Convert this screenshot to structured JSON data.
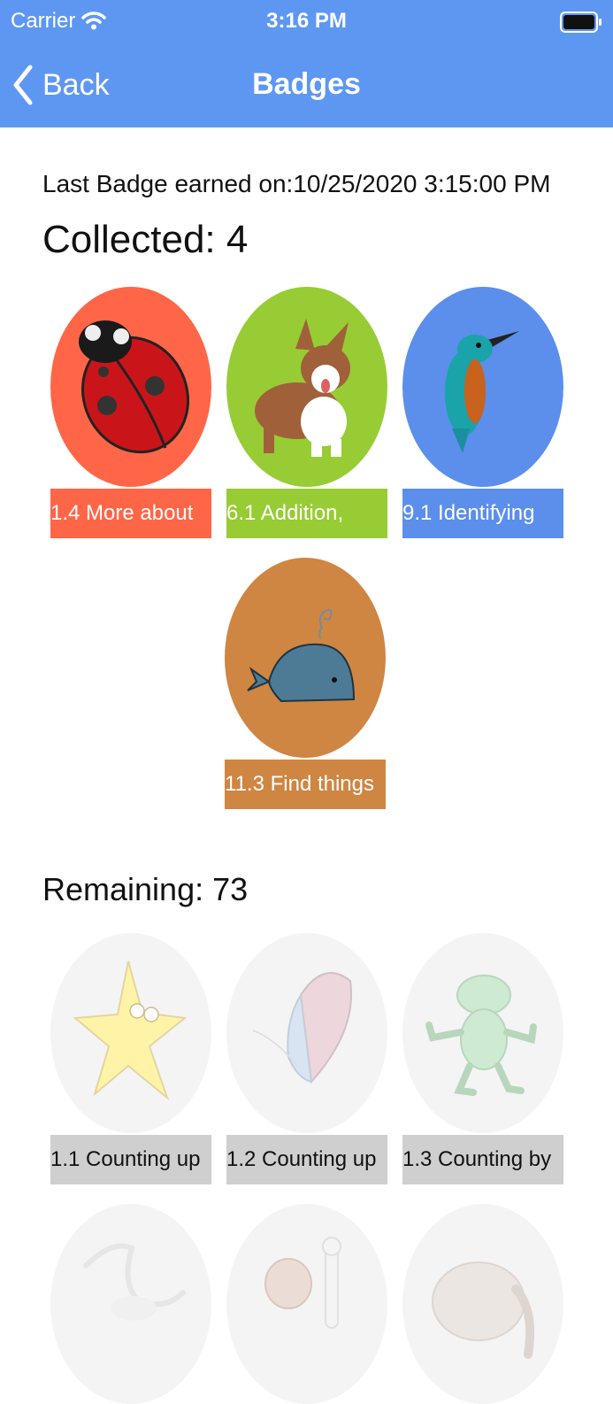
{
  "status_bar": {
    "carrier": "Carrier",
    "time": "3:16 PM"
  },
  "nav": {
    "back_label": "Back",
    "title": "Badges",
    "color": "#5e97f2"
  },
  "last_badge": "Last Badge earned on:10/25/2020 3:15:00 PM",
  "collected": {
    "title": "Collected: 4",
    "items": [
      {
        "caption": "1.4 More about",
        "color": "#ff6647",
        "icon": "ladybug-icon"
      },
      {
        "caption": "6.1 Addition,",
        "color": "#97cc34",
        "icon": "corgi-icon"
      },
      {
        "caption": "9.1 Identifying",
        "color": "#5b8feb",
        "icon": "kingfisher-icon"
      },
      {
        "caption": "11.3 Find things",
        "color": "#cf8642",
        "icon": "whale-icon"
      }
    ]
  },
  "remaining": {
    "title": "Remaining: 73",
    "items": [
      {
        "caption": "1.1 Counting up",
        "icon": "starfish-icon"
      },
      {
        "caption": "1.2 Counting up",
        "icon": "butterfly-icon"
      },
      {
        "caption": "1.3 Counting by",
        "icon": "frog-icon"
      },
      {
        "caption": "",
        "icon": "crane-icon"
      },
      {
        "caption": "",
        "icon": "dog-bone-icon"
      },
      {
        "caption": "",
        "icon": "elephant-icon"
      }
    ]
  }
}
